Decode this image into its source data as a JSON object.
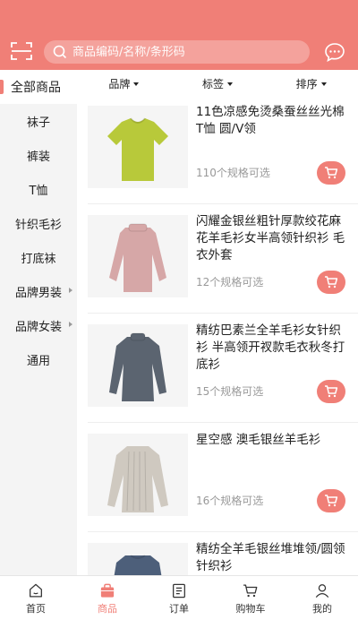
{
  "search": {
    "placeholder": "商品编码/名称/条形码"
  },
  "categories": [
    {
      "label": "全部商品",
      "active": true,
      "sub": false
    },
    {
      "label": "袜子",
      "sub": false
    },
    {
      "label": "裤装",
      "sub": false
    },
    {
      "label": "T恤",
      "sub": false
    },
    {
      "label": "针织毛衫",
      "sub": false
    },
    {
      "label": "打底袜",
      "sub": false
    },
    {
      "label": "品牌男装",
      "sub": true
    },
    {
      "label": "品牌女装",
      "sub": true
    },
    {
      "label": "通用",
      "sub": false
    }
  ],
  "filters": [
    "品牌",
    "标签",
    "排序"
  ],
  "products": [
    {
      "title": "11色凉感免烫桑蚕丝丝光棉T恤 圆/V领",
      "specs": "110个规格可选",
      "image": "lime-tshirt",
      "color": "#b8c93a"
    },
    {
      "title": "闪耀金银丝粗针厚款绞花麻花羊毛衫女半高领针织衫 毛衣外套",
      "specs": "12个规格可选",
      "image": "pink-knit-sweater",
      "color": "#d6a7a7"
    },
    {
      "title": "精纺巴素兰全羊毛衫女针织衫 半高领开衩款毛衣秋冬打底衫",
      "specs": "15个规格可选",
      "image": "gray-knit-top",
      "color": "#5b6470"
    },
    {
      "title": "星空感 澳毛银丝羊毛衫",
      "specs": "16个规格可选",
      "image": "beige-ribbed-sweater",
      "color": "#cfc9c0"
    },
    {
      "title": "精纺全羊毛银丝堆堆领/圆领针织衫",
      "specs": "",
      "image": "blue-sweater",
      "color": "#4d5f7a"
    }
  ],
  "tabs": [
    {
      "label": "首页",
      "icon": "home-icon"
    },
    {
      "label": "商品",
      "icon": "bag-icon",
      "active": true
    },
    {
      "label": "订单",
      "icon": "order-icon"
    },
    {
      "label": "购物车",
      "icon": "cart-icon"
    },
    {
      "label": "我的",
      "icon": "user-icon"
    }
  ],
  "colors": {
    "accent": "#f07f77",
    "sidebar": "#f4f4f4"
  }
}
